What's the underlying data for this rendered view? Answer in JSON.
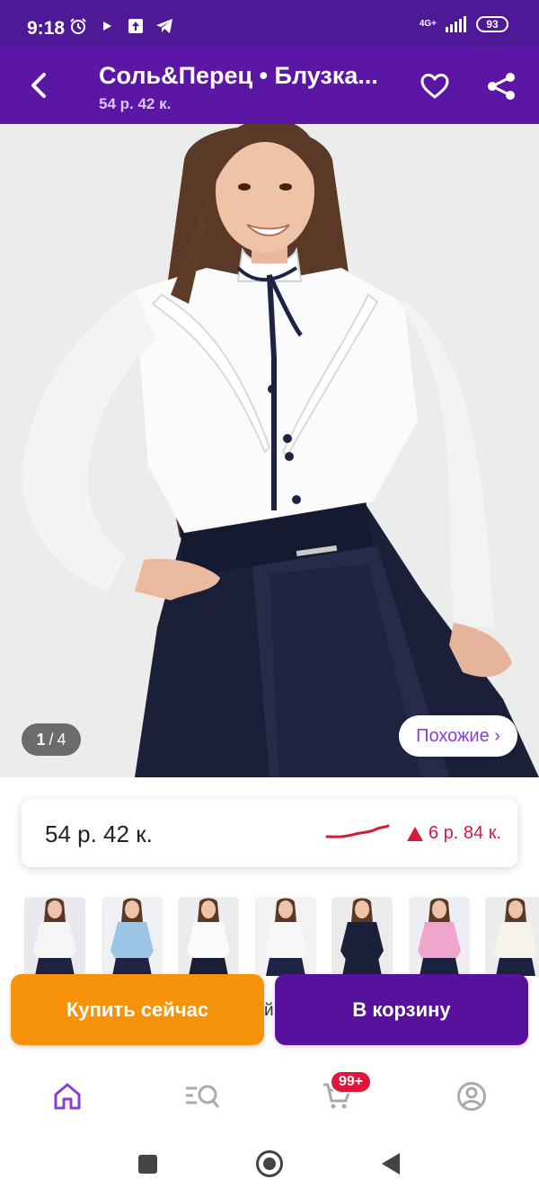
{
  "status_bar": {
    "time": "9:18",
    "network": "4G+",
    "battery": "93"
  },
  "header": {
    "title": "Соль&Перец • Блузка...",
    "subtitle": "54 р. 42 к."
  },
  "gallery": {
    "current_page": "1",
    "separator": "/",
    "total_pages": "4",
    "similar_label": "Похожие ›"
  },
  "price_card": {
    "price": "54 р. 42 к.",
    "change": "6 р. 84 к.",
    "change_color": "#d21b3d"
  },
  "thumbnails": [
    {
      "name": "white blouse with bow",
      "bg": "#e8e8ee",
      "top": "#f5f5f5",
      "bottom": "#1d2340"
    },
    {
      "name": "blue blouse",
      "bg": "#eef0f4",
      "top": "#9cc4e4",
      "bottom": "#1d2340"
    },
    {
      "name": "white blouse dark collar",
      "bg": "#ececec",
      "top": "#fafafa",
      "bottom": "#1a1f38"
    },
    {
      "name": "white blouse school label",
      "bg": "#f2f2f2",
      "top": "#f7f7f7",
      "bottom": "#1c2545"
    },
    {
      "name": "navy blouse",
      "bg": "#ebebeb",
      "top": "#1a2038",
      "bottom": "#1a2038"
    },
    {
      "name": "pink blouse",
      "bg": "#efeef2",
      "top": "#f0a6cc",
      "bottom": "#1b2240"
    },
    {
      "name": "cream blouse",
      "bg": "#ececec",
      "top": "#f7f4ee",
      "bottom": "#1c2340"
    }
  ],
  "actions": {
    "buy_now": "Купить сейчас",
    "add_to_cart": "В корзину",
    "buy_now_color": "#f7930a",
    "cart_color": "#58119c"
  },
  "bottom_nav": {
    "items": [
      "home-icon",
      "catalog-search-icon",
      "cart-icon",
      "profile-icon"
    ],
    "cart_badge": "99+",
    "active_color": "#8a3fd1"
  },
  "colors": {
    "status_bar": "#4e1896",
    "header": "#5b16a6"
  }
}
